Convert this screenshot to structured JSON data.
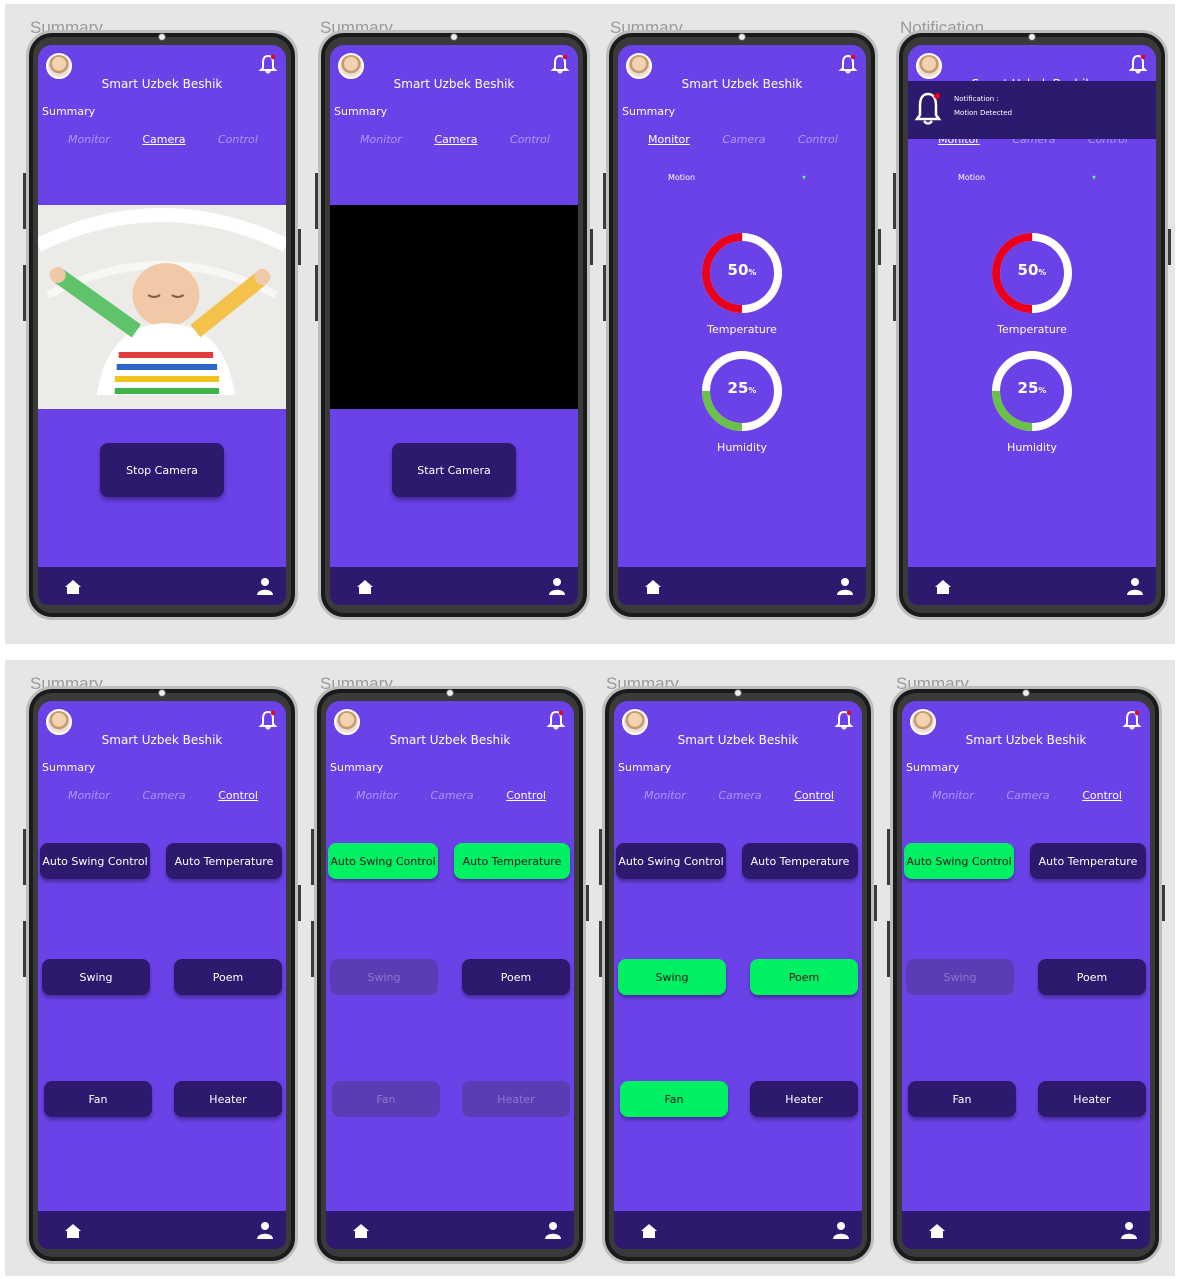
{
  "frames": [
    {
      "label": "Summary",
      "variant": "camera-on",
      "tabs_active": "camera",
      "button": "Stop Camera"
    },
    {
      "label": "Summary",
      "variant": "camera-off",
      "tabs_active": "camera",
      "button": "Start Camera"
    },
    {
      "label": "Summary",
      "variant": "monitor",
      "tabs_active": "monitor"
    },
    {
      "label": "Notification",
      "variant": "notification",
      "tabs_active": "monitor"
    },
    {
      "label": "Summary",
      "variant": "control-all-off"
    },
    {
      "label": "Summary",
      "variant": "control-auto-on"
    },
    {
      "label": "Summary",
      "variant": "control-manual-on"
    },
    {
      "label": "Summary",
      "variant": "control-swing-auto"
    }
  ],
  "app": {
    "title": "Smart Uzbek Beshik",
    "summary_label": "Summary",
    "tabs": {
      "monitor": "Monitor",
      "camera": "Camera",
      "control": "Control"
    }
  },
  "camera": {
    "stop_label": "Stop Camera",
    "start_label": "Start Camera"
  },
  "monitor": {
    "motion_label": "Motion",
    "motion_indicator": "▾",
    "temperature": {
      "value": "50",
      "unit": "%",
      "label": "Temperature",
      "fraction": 0.5,
      "color": "#e8001c"
    },
    "humidity": {
      "value": "25",
      "unit": "%",
      "label": "Humidity",
      "fraction": 0.25,
      "color": "#6ac04a"
    }
  },
  "notification": {
    "title": "Notification :",
    "text": "Motion Detected"
  },
  "controls": {
    "auto_swing": "Auto Swing Control",
    "auto_temp": "Auto Temperature",
    "swing": "Swing",
    "poem": "Poem",
    "fan": "Fan",
    "heater": "Heater"
  },
  "colors": {
    "screen": "#6b41e8",
    "dark": "#2d1a6e",
    "on": "#00f064",
    "accent_red": "#e8001c"
  }
}
